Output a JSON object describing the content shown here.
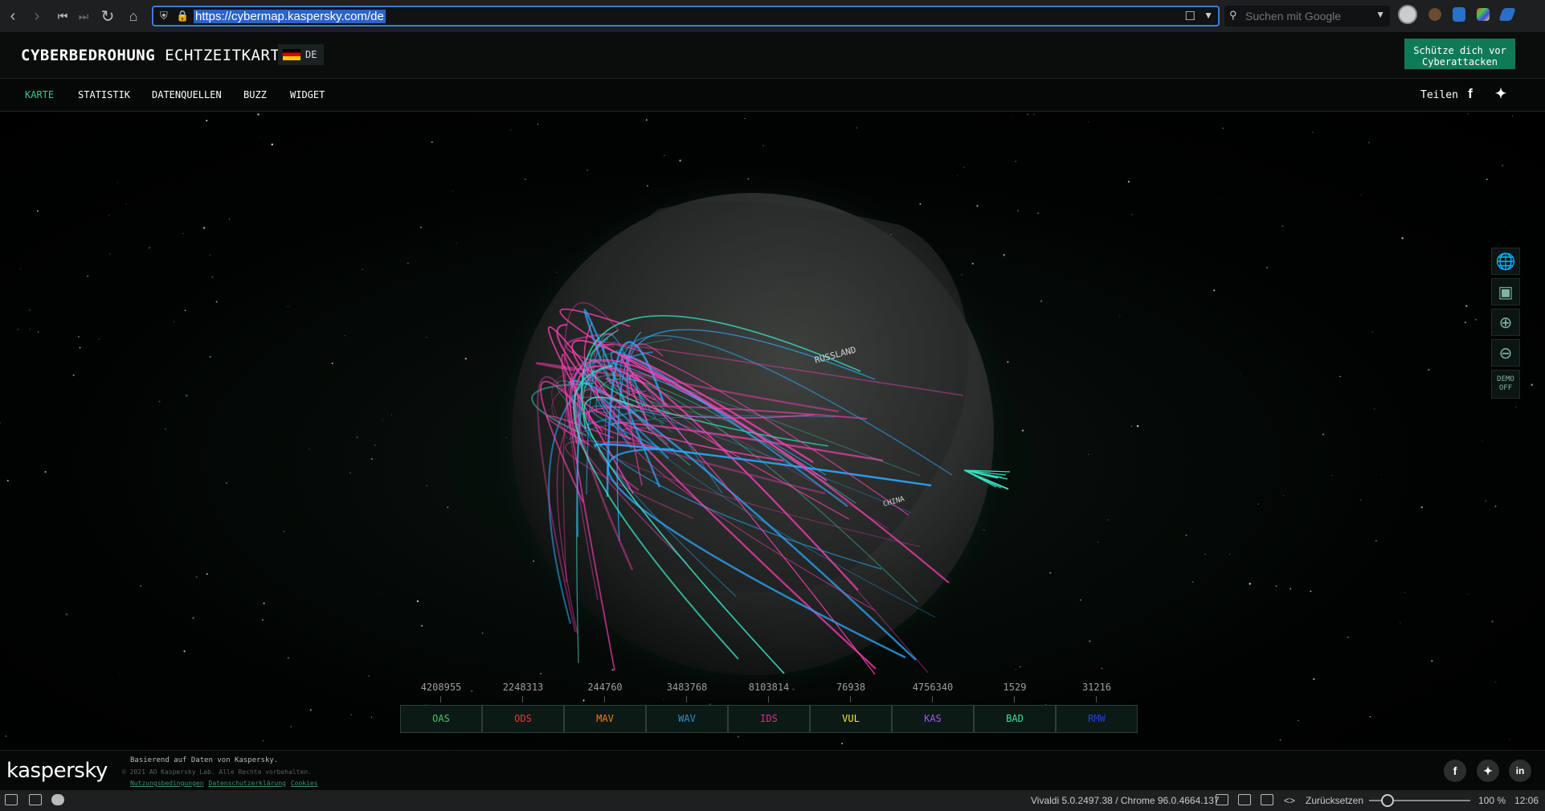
{
  "browser": {
    "url": "https://cybermap.kaspersky.com/de",
    "search_placeholder": "Suchen mit Google"
  },
  "header": {
    "title_bold": "CYBERBEDROHUNG",
    "title_light": "ECHTZEITKARTE",
    "lang": "DE",
    "cta": "Schütze dich vor Cyberattacken"
  },
  "nav": {
    "items": [
      "KARTE",
      "STATISTIK",
      "DATENQUELLEN",
      "BUZZ",
      "WIDGET"
    ],
    "active": "KARTE",
    "share": "Teilen"
  },
  "map": {
    "labels": {
      "russia": "RUSSLAND",
      "china": "CHINA"
    },
    "demo": "DEMO OFF"
  },
  "counters": [
    {
      "value": "4208955",
      "label": "OAS",
      "color": "#4cbf6e"
    },
    {
      "value": "2248313",
      "label": "ODS",
      "color": "#e4383a"
    },
    {
      "value": "244760",
      "label": "MAV",
      "color": "#f07a2a"
    },
    {
      "value": "3483768",
      "label": "WAV",
      "color": "#2c8ee0"
    },
    {
      "value": "8103814",
      "label": "IDS",
      "color": "#e42a8a"
    },
    {
      "value": "76938",
      "label": "VUL",
      "color": "#f4e14a"
    },
    {
      "value": "4756340",
      "label": "KAS",
      "color": "#9b5ae6"
    },
    {
      "value": "1529",
      "label": "BAD",
      "color": "#3ee0a0"
    },
    {
      "value": "31216",
      "label": "RMW",
      "color": "#1f3fd8"
    }
  ],
  "footer": {
    "brand": "kaspersky",
    "line1": "Basierend auf Daten von Kaspersky.",
    "line2": "© 2021 AO Kaspersky Lab. Alle Rechte vorbehalten.",
    "links": [
      "Nutzungsbedingungen",
      "Datenschutzerklärung",
      "Cookies"
    ]
  },
  "status": {
    "version": "Vivaldi 5.0.2497.38 / Chrome 96.0.4664.137",
    "reset": "Zurücksetzen",
    "zoom": "100 %",
    "time": "12:06"
  }
}
